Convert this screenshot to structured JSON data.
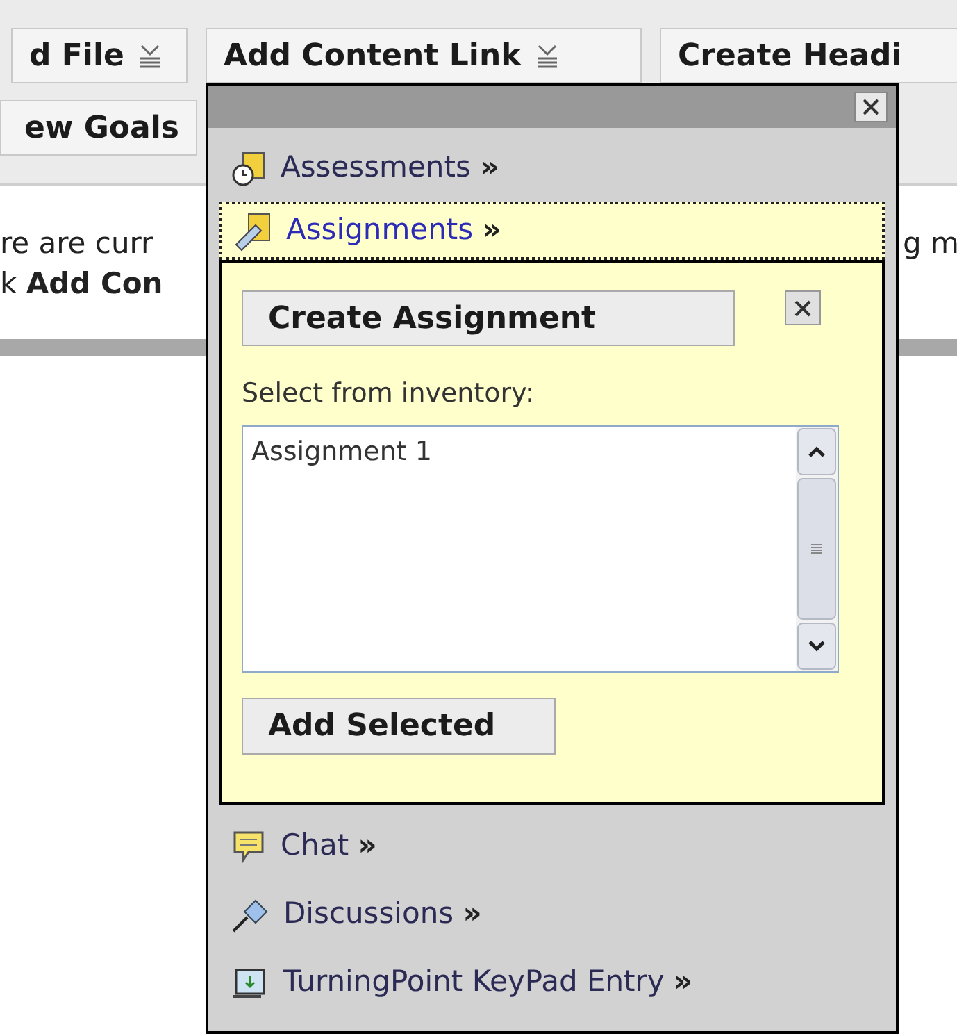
{
  "toolbar": {
    "rows": [
      [
        {
          "label": "d File",
          "dropdown": true
        },
        {
          "label": "Add Content Link",
          "dropdown": true
        },
        {
          "label": "Create Headi",
          "dropdown": false
        }
      ],
      [
        {
          "label": "ew Goals",
          "dropdown": false
        }
      ]
    ]
  },
  "page_text": {
    "left_lines": [
      "re are curr",
      "k **Add Con**"
    ],
    "right_line": "g m"
  },
  "menu": {
    "items": [
      {
        "kind": "assessment",
        "label": "Assessments",
        "more": "»",
        "selected": false
      },
      {
        "kind": "assignment",
        "label": "Assignments",
        "more": "»",
        "selected": true
      },
      {
        "kind": "chat",
        "label": "Chat",
        "more": "»",
        "selected": false
      },
      {
        "kind": "discussion",
        "label": "Discussions",
        "more": "»",
        "selected": false
      },
      {
        "kind": "keypad",
        "label": "TurningPoint KeyPad Entry",
        "more": "»",
        "selected": false
      }
    ],
    "panel": {
      "create_button": "Create Assignment",
      "list_label": "Select from inventory:",
      "options": [
        {
          "label": "Assignment 1",
          "selected": false
        }
      ],
      "add_button": "Add Selected"
    }
  }
}
